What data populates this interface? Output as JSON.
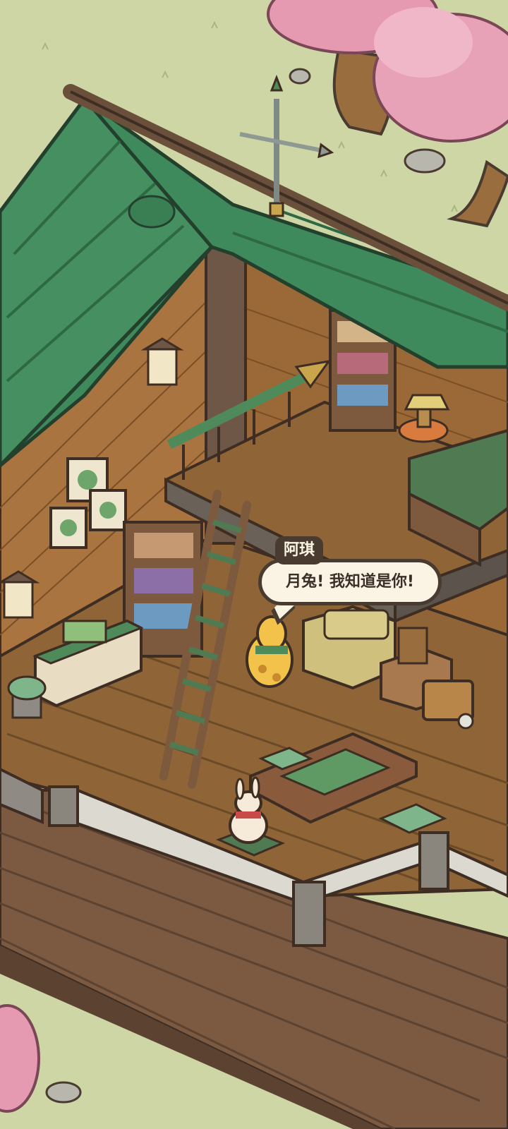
{
  "dialogue": {
    "speaker": "阿琪",
    "text": "月兔! 我知道是你!"
  },
  "palette": {
    "grass": "#cfd6a6",
    "roof": "#3f8a5c",
    "brick": "#a9743f",
    "floor": "#8f6537",
    "deck": "#7b5a41",
    "cherry": "#e59ab1"
  }
}
